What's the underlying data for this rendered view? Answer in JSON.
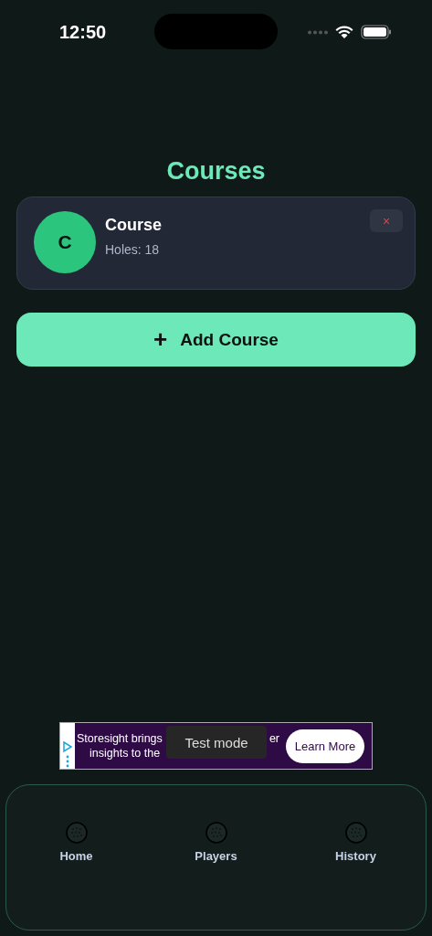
{
  "status_bar": {
    "time": "12:50"
  },
  "title": "Courses",
  "courses": [
    {
      "initial": "C",
      "name": "Course",
      "holes": "Holes: 18",
      "delete": "×"
    }
  ],
  "add_button": {
    "icon": "+",
    "label": "Add Course"
  },
  "ad": {
    "line_1": "Storesight brings",
    "line_1_end": "er",
    "line_2": "insights to the",
    "cta": "Learn More",
    "toast": "Test mode"
  },
  "tabs": [
    {
      "label": "Home",
      "selected": false
    },
    {
      "label": "Players",
      "selected": false
    },
    {
      "label": "History",
      "selected": false
    }
  ]
}
